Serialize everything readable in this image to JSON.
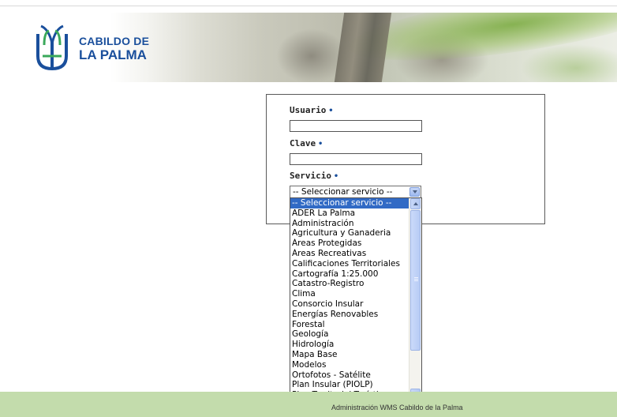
{
  "logo": {
    "line1": "CABILDO DE",
    "line2": "LA PALMA",
    "icon": "cabildo-emblem-icon",
    "color": "#1a4f9c"
  },
  "form": {
    "usuario_label": "Usuario",
    "clave_label": "Clave",
    "servicio_label": "Servicio",
    "required_marker": "•",
    "usuario_value": "",
    "clave_value": "",
    "servicio_selected": "-- Seleccionar servicio --"
  },
  "dropdown": {
    "options": [
      "-- Seleccionar servicio --",
      "ADER La Palma",
      "Administración",
      "Agricultura y Ganaderia",
      "Áreas Protegidas",
      "Áreas Recreativas",
      "Calificaciones Territoriales",
      "Cartografía 1:25.000",
      "Catastro-Registro",
      "Clima",
      "Consorcio Insular",
      "Energías Renovables",
      "Forestal",
      "Geología",
      "Hidrología",
      "Mapa Base",
      "Modelos",
      "Ortofotos - Satélite",
      "Plan Insular (PIOLP)",
      "Plan Territorial Turístico"
    ],
    "highlighted_index": 0,
    "highlight_color": "#316ac5"
  },
  "footer": {
    "text": "Administración WMS Cabildo de la Palma",
    "color": "#c3dcac"
  }
}
